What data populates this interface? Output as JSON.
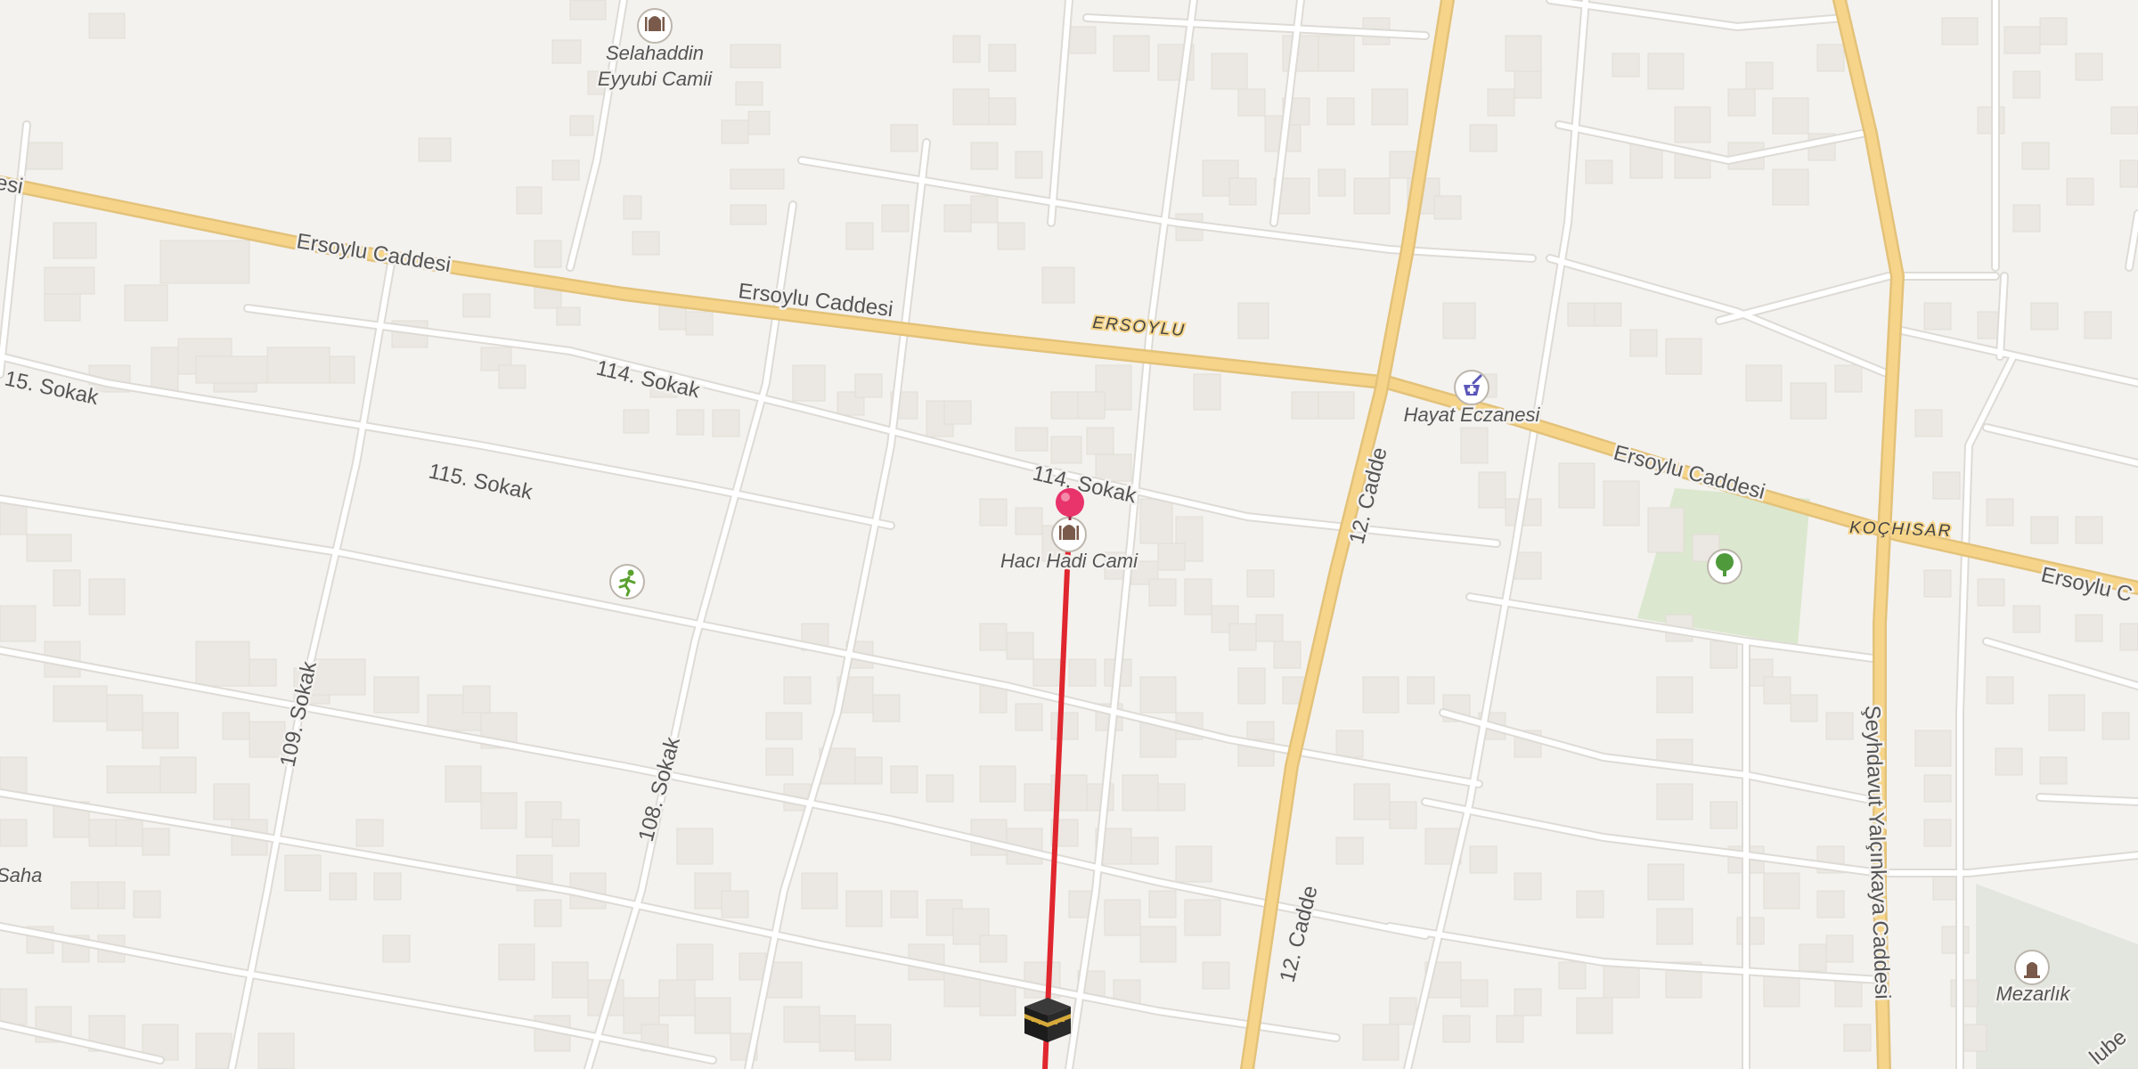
{
  "roads": {
    "ersoylu_1": "Ersoylu Caddesi",
    "ersoylu_2": "Ersoylu Caddesi",
    "ersoylu_3": "Ersoylu Caddesi",
    "ersoylu_4": "Ersoylu C",
    "ersoylu_edge": "esi",
    "ersoylu_caps": "ERSOYLU",
    "kochisar_caps": "KOÇHISAR",
    "s114_a": "114. Sokak",
    "s114_b": "114. Sokak",
    "s115_a": "15. Sokak",
    "s115_b": "115. Sokak",
    "s109": "109. Sokak",
    "s108": "108. Sokak",
    "cadde12_a": "12. Cadde",
    "cadde12_b": "12. Cadde",
    "seyhdavut": "Şeyhdavut Yalçınkaya Caddesi",
    "edge_bottom_right": "lube"
  },
  "pois": {
    "selahaddin_line1": "Selahaddin",
    "selahaddin_line2": "Eyyubi Camii",
    "haci_hadi": "Hacı Hadi Cami",
    "hayat": "Hayat Eczanesi",
    "mezarlik": "Mezarlık",
    "saha": "Saha"
  },
  "icons": {
    "mosque": "mosque-icon",
    "pharmacy": "pharmacy-icon",
    "park": "tree-icon",
    "sports": "running-icon",
    "cemetery": "tombstone-icon",
    "kaaba": "kaaba-icon",
    "pin": "location-pin-icon"
  },
  "colors": {
    "background": "#f4f2ef",
    "major_road": "#f6d58a",
    "minor_road": "#ffffff",
    "building": "#ebe7e2",
    "park": "#dbe8cf",
    "cemetery": "#e2e6df",
    "qibla_line": "#e0262e",
    "pin": "#e8336b"
  }
}
